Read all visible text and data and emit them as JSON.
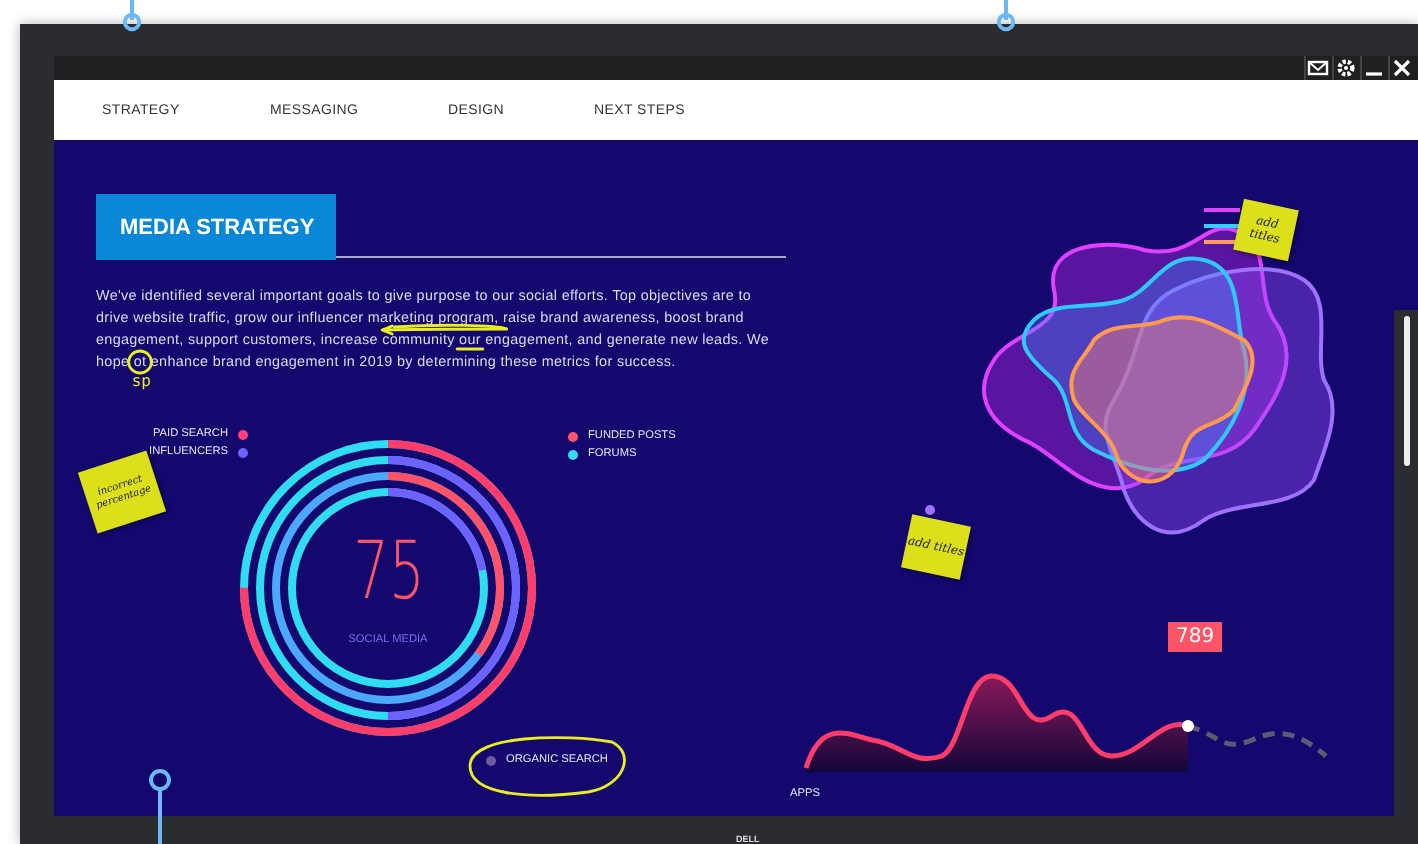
{
  "window_controls": [
    {
      "kind": "mail"
    },
    {
      "kind": "settings"
    },
    {
      "kind": "minimize"
    },
    {
      "kind": "close"
    }
  ],
  "nav": [
    "STRATEGY",
    "MESSAGING",
    "DESIGN",
    "NEXT STEPS"
  ],
  "heading": "MEDIA STRATEGY",
  "paragraph": "We've identified several important goals to give purpose to our social efforts. Top objectives are to drive website traffic, grow our influencer marketing program, raise brand awareness, boost brand engagement, support customers, increase community our engagement, and generate new leads. We hope ot enhance brand engagement in 2019 by determining these metrics for success.",
  "donut": {
    "value": "75",
    "label": "SOCIAL MEDIA",
    "legend_left": [
      {
        "label": "PAID SEARCH",
        "color": "#ff3d7f"
      },
      {
        "label": "INFLUENCERS",
        "color": "#6d62ff"
      }
    ],
    "legend_right": [
      {
        "label": "FUNDED POSTS",
        "color": "#ff5468"
      },
      {
        "label": "FORUMS",
        "color": "#2fdcf2"
      }
    ],
    "legend_bottom": [
      {
        "label": "ORGANIC SEARCH",
        "color": "#6c5c9e"
      }
    ]
  },
  "trend": {
    "label": "APPS",
    "callout": "789"
  },
  "notes": [
    "add titles",
    "add titles",
    "incorrect percentage"
  ],
  "ink_note": "sp",
  "monitor": {
    "brand": "DELL"
  }
}
